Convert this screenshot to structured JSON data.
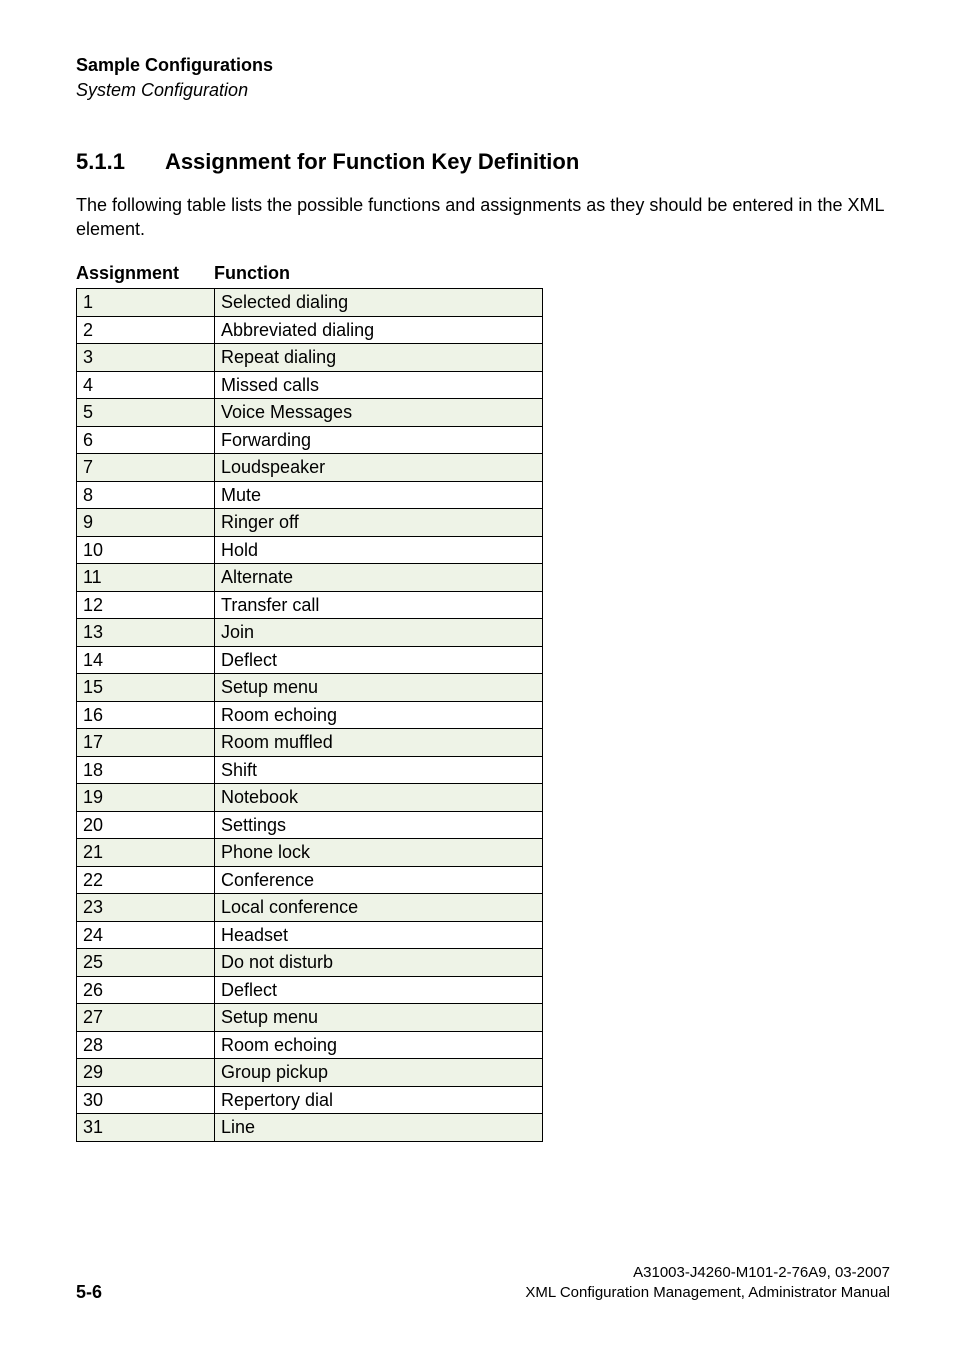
{
  "header": {
    "title": "Sample Configurations",
    "subtitle": "System Configuration"
  },
  "section": {
    "number": "5.1.1",
    "title": "Assignment for Function Key Definition"
  },
  "intro": "The following table lists the possible functions and assignments as they should be entered in the XML element.",
  "table": {
    "col_assignment_label": "Assignment",
    "col_function_label": "Function",
    "rows": [
      {
        "assignment": "1",
        "function": "Selected dialing"
      },
      {
        "assignment": "2",
        "function": "Abbreviated dialing"
      },
      {
        "assignment": "3",
        "function": "Repeat dialing"
      },
      {
        "assignment": "4",
        "function": "Missed calls"
      },
      {
        "assignment": "5",
        "function": "Voice Messages"
      },
      {
        "assignment": "6",
        "function": "Forwarding"
      },
      {
        "assignment": "7",
        "function": "Loudspeaker"
      },
      {
        "assignment": "8",
        "function": "Mute"
      },
      {
        "assignment": "9",
        "function": "Ringer off"
      },
      {
        "assignment": "10",
        "function": "Hold"
      },
      {
        "assignment": "11",
        "function": "Alternate"
      },
      {
        "assignment": "12",
        "function": "Transfer call"
      },
      {
        "assignment": "13",
        "function": "Join"
      },
      {
        "assignment": "14",
        "function": "Deflect"
      },
      {
        "assignment": "15",
        "function": "Setup menu"
      },
      {
        "assignment": "16",
        "function": "Room echoing"
      },
      {
        "assignment": "17",
        "function": "Room muffled"
      },
      {
        "assignment": "18",
        "function": "Shift"
      },
      {
        "assignment": "19",
        "function": "Notebook"
      },
      {
        "assignment": "20",
        "function": "Settings"
      },
      {
        "assignment": "21",
        "function": "Phone lock"
      },
      {
        "assignment": "22",
        "function": "Conference"
      },
      {
        "assignment": "23",
        "function": "Local conference"
      },
      {
        "assignment": "24",
        "function": "Headset"
      },
      {
        "assignment": "25",
        "function": "Do not disturb"
      },
      {
        "assignment": "26",
        "function": "Deflect"
      },
      {
        "assignment": "27",
        "function": "Setup menu"
      },
      {
        "assignment": "28",
        "function": "Room echoing"
      },
      {
        "assignment": "29",
        "function": "Group pickup"
      },
      {
        "assignment": "30",
        "function": "Repertory dial"
      },
      {
        "assignment": "31",
        "function": "Line"
      }
    ]
  },
  "footer": {
    "page": "5-6",
    "doc_id": "A31003-J4260-M101-2-76A9, 03-2007",
    "doc_title": "XML Configuration Management, Administrator Manual"
  }
}
